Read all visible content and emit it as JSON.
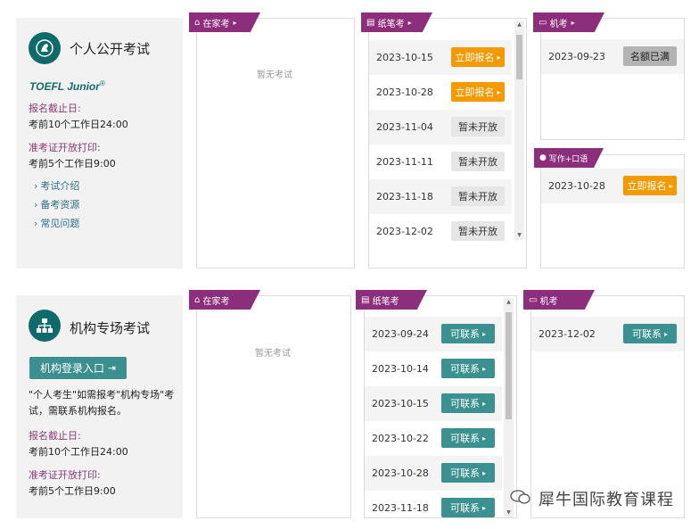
{
  "personal": {
    "title": "个人公开考试",
    "brand": "TOEFL Junior",
    "brand_mark": "®",
    "deadline_label": "报名截止日:",
    "deadline_value": "考前10个工作日24:00",
    "admission_label": "准考证开放打印:",
    "admission_value": "考前5个工作日9:00",
    "links": [
      "考试介绍",
      "备考资源",
      "常见问题"
    ]
  },
  "institution": {
    "title": "机构专场考试",
    "login_button": "机构登录入口",
    "note": "\"个人考生\"如需报考\"机构专场\"考试，需联系机构报名。",
    "deadline_label": "报名截止日:",
    "deadline_value": "考前10个工作日24:00",
    "admission_label": "准考证开放打印:",
    "admission_value": "考前5个工作日9:00"
  },
  "tags": {
    "home": "在家考",
    "paper": "纸笔考",
    "computer": "机考",
    "writing_speaking": "写作+口语"
  },
  "empty_text": "暂无考试",
  "personal_paper_rows": [
    {
      "date": "2023-10-15",
      "action": "立即报名"
    },
    {
      "date": "2023-10-28",
      "action": "立即报名"
    },
    {
      "date": "2023-11-04",
      "action": "暂未开放"
    },
    {
      "date": "2023-11-11",
      "action": "暂未开放"
    },
    {
      "date": "2023-11-18",
      "action": "暂未开放"
    },
    {
      "date": "2023-12-02",
      "action": "暂未开放"
    }
  ],
  "personal_computer_rows": [
    {
      "date": "2023-09-23",
      "action": "名额已满"
    }
  ],
  "personal_ws_rows": [
    {
      "date": "2023-10-28",
      "action": "立即报名"
    }
  ],
  "institution_paper_rows": [
    {
      "date": "2023-09-24",
      "action": "可联系"
    },
    {
      "date": "2023-10-14",
      "action": "可联系"
    },
    {
      "date": "2023-10-15",
      "action": "可联系"
    },
    {
      "date": "2023-10-22",
      "action": "可联系"
    },
    {
      "date": "2023-10-28",
      "action": "可联系"
    },
    {
      "date": "2023-11-18",
      "action": "可联系"
    }
  ],
  "institution_computer_rows": [
    {
      "date": "2023-12-02",
      "action": "可联系"
    }
  ],
  "watermark": "犀牛国际教育课程",
  "colors": {
    "tag": "#8c2e7c",
    "orange": "#f39a00",
    "teal": "#3b9090",
    "label": "#8c3a7a"
  }
}
